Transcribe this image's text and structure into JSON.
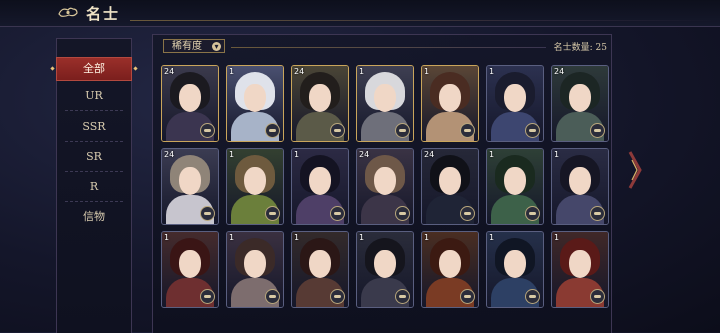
{
  "header": {
    "title": "名士"
  },
  "sidebar": {
    "items": [
      {
        "label": "全部",
        "active": true
      },
      {
        "label": "UR",
        "active": false
      },
      {
        "label": "SSR",
        "active": false
      },
      {
        "label": "SR",
        "active": false
      },
      {
        "label": "R",
        "active": false
      },
      {
        "label": "信物",
        "active": false
      }
    ]
  },
  "toolbar": {
    "sort_label": "稀有度",
    "count_label": "名士数量: 25"
  },
  "cards": [
    {
      "badge": "24",
      "frame": "gold",
      "bg": "#3b3a4c",
      "hair": "#1b1a20",
      "robe": "#3b3550"
    },
    {
      "badge": "1",
      "frame": "gold",
      "bg": "#4a5070",
      "hair": "#dfe2ea",
      "robe": "#a7b3c8"
    },
    {
      "badge": "24",
      "frame": "gold",
      "bg": "#4a4536",
      "hair": "#221e1c",
      "robe": "#5b5a48"
    },
    {
      "badge": "1",
      "frame": "gold",
      "bg": "#3e3f52",
      "hair": "#d8d8dc",
      "robe": "#6e6f7a"
    },
    {
      "badge": "1",
      "frame": "gold",
      "bg": "#5a4636",
      "hair": "#4a2c22",
      "robe": "#b39275"
    },
    {
      "badge": "1",
      "frame": "dark",
      "bg": "#2c3150",
      "hair": "#1a1c2e",
      "robe": "#3d4670"
    },
    {
      "badge": "24",
      "frame": "dark",
      "bg": "#2e3a3a",
      "hair": "#1c2624",
      "robe": "#4b5d58"
    },
    {
      "badge": "24",
      "frame": "dark",
      "bg": "#3b3c52",
      "hair": "#8f8478",
      "robe": "#c7c5ce"
    },
    {
      "badge": "1",
      "frame": "dark",
      "bg": "#334030",
      "hair": "#6e5a3e",
      "robe": "#6b7f3b"
    },
    {
      "badge": "1",
      "frame": "dark",
      "bg": "#2c2a44",
      "hair": "#141322",
      "robe": "#4e3f67"
    },
    {
      "badge": "24",
      "frame": "dark",
      "bg": "#3a3344",
      "hair": "#6e5848",
      "robe": "#3c3548"
    },
    {
      "badge": "24",
      "frame": "dark",
      "bg": "#262838",
      "hair": "#101118",
      "robe": "#1f2436"
    },
    {
      "badge": "1",
      "frame": "dark",
      "bg": "#2e4036",
      "hair": "#1a2a1f",
      "robe": "#3d6149"
    },
    {
      "badge": "1",
      "frame": "dark",
      "bg": "#2a2c44",
      "hair": "#161624",
      "robe": "#45476a"
    },
    {
      "badge": "1",
      "frame": "dark",
      "bg": "#452b2c",
      "hair": "#3a1515",
      "robe": "#6e2f30"
    },
    {
      "badge": "1",
      "frame": "dark",
      "bg": "#3a3040",
      "hair": "#3b2a28",
      "robe": "#7d6d6e"
    },
    {
      "badge": "1",
      "frame": "dark",
      "bg": "#332a2a",
      "hair": "#2b1716",
      "robe": "#573a34"
    },
    {
      "badge": "1",
      "frame": "dark",
      "bg": "#2a2c3a",
      "hair": "#15151d",
      "robe": "#3a3a4c"
    },
    {
      "badge": "1",
      "frame": "dark",
      "bg": "#4a2e22",
      "hair": "#3c1a12",
      "robe": "#7a3b24"
    },
    {
      "badge": "1",
      "frame": "dark",
      "bg": "#25304a",
      "hair": "#101624",
      "robe": "#2d4064"
    },
    {
      "badge": "1",
      "frame": "dark",
      "bg": "#402828",
      "hair": "#5a1a18",
      "robe": "#8a3a32"
    }
  ],
  "colors": {
    "accent": "#9a2f2a",
    "gold": "#c9a55b"
  }
}
